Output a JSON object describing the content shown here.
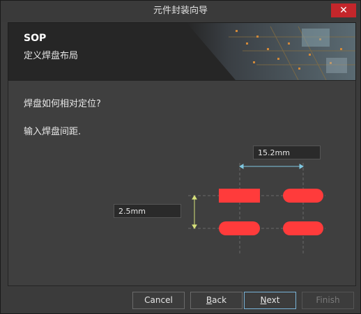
{
  "window": {
    "title": "元件封装向导",
    "close_icon": "close-icon"
  },
  "banner": {
    "title": "SOP",
    "subtitle": "定义焊盘布局"
  },
  "content": {
    "question": "焊盘如何相对定位?",
    "instruction": "输入焊盘间距."
  },
  "fields": {
    "horizontal_spacing": "15.2mm",
    "vertical_spacing": "2.5mm"
  },
  "buttons": {
    "cancel": "Cancel",
    "back_underline": "B",
    "back_rest": "ack",
    "next_underline": "N",
    "next_rest": "ext",
    "finish": "Finish"
  },
  "colors": {
    "pad": "#ff3b3b",
    "dimension_horizontal": "#7fc7e0",
    "dimension_vertical": "#d6e07a",
    "accent_border": "#7ab4d8"
  }
}
